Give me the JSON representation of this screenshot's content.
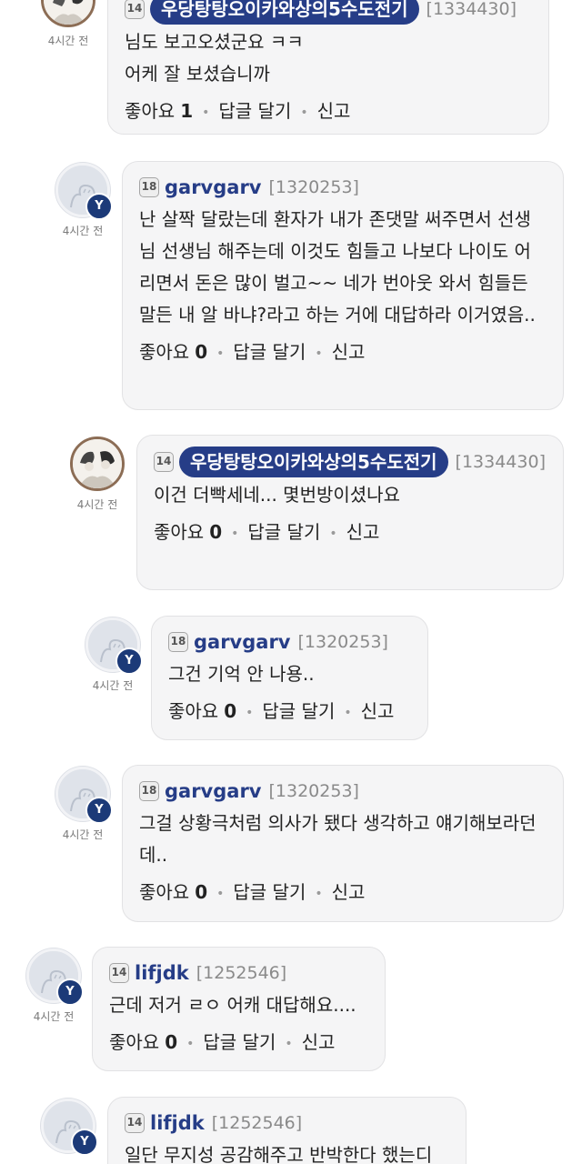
{
  "comments": [
    {
      "level": "14",
      "nick": "우당탕탕오이카와상의5수도전기",
      "uid": "[1334430]",
      "time": "4시간 전",
      "text": "님도 보고오셨군요 ㅋㅋ\n어케 잘 보셨습니까",
      "like_label": "좋아요",
      "like_count": "1",
      "reply_label": "답글 달기",
      "report_label": "신고"
    },
    {
      "level": "18",
      "nick": "garvgarv",
      "uid": "[1320253]",
      "time": "4시간 전",
      "text": "난 살짝 달랐는데 환자가 내가 존댓말 써주면서 선생님 선생님 해주는데 이것도 힘들고 나보다 나이도 어리면서 돈은 많이 벌고~~ 네가 번아웃 와서 힘들든 말든 내 알 바냐?라고 하는 거에 대답하라 이거였음..",
      "like_label": "좋아요",
      "like_count": "0",
      "reply_label": "답글 달기",
      "report_label": "신고"
    },
    {
      "level": "14",
      "nick": "우당탕탕오이카와상의5수도전기",
      "uid": "[1334430]",
      "time": "4시간 전",
      "text": "이건 더빡세네... 몇번방이셨나요",
      "like_label": "좋아요",
      "like_count": "0",
      "reply_label": "답글 달기",
      "report_label": "신고"
    },
    {
      "level": "18",
      "nick": "garvgarv",
      "uid": "[1320253]",
      "time": "4시간 전",
      "text": "그건 기억 안 나용..",
      "like_label": "좋아요",
      "like_count": "0",
      "reply_label": "답글 달기",
      "report_label": "신고"
    },
    {
      "level": "18",
      "nick": "garvgarv",
      "uid": "[1320253]",
      "time": "4시간 전",
      "text": "그걸 상황극처럼 의사가 됐다 생각하고 얘기해보라던데..",
      "like_label": "좋아요",
      "like_count": "0",
      "reply_label": "답글 달기",
      "report_label": "신고"
    },
    {
      "level": "14",
      "nick": "lifjdk",
      "uid": "[1252546]",
      "time": "4시간 전",
      "text": "근데 저거 ㄹㅇ 어캐 대답해요....",
      "like_label": "좋아요",
      "like_count": "0",
      "reply_label": "답글 달기",
      "report_label": "신고"
    },
    {
      "level": "14",
      "nick": "lifjdk",
      "uid": "[1252546]",
      "time": "",
      "text": "일단 무지성 공감해주고 반박한다 했는디",
      "like_label": "",
      "like_count": "",
      "reply_label": "",
      "report_label": ""
    }
  ],
  "badge_letter": "Y"
}
